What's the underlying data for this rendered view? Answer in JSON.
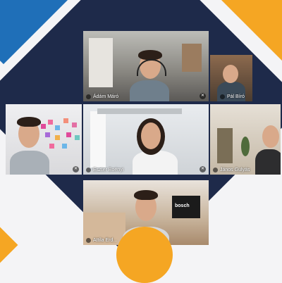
{
  "participants": [
    {
      "name": "Ádám Máró"
    },
    {
      "name": "Pál Bíró"
    },
    {
      "name": ""
    },
    {
      "name": "Eszter Boényi"
    },
    {
      "name": "János Gulyás"
    },
    {
      "name": "Attila Erd..."
    }
  ],
  "screen_label": "bosch",
  "colors": {
    "navy": "#1e2a4a",
    "orange": "#f5a623",
    "blue": "#1f6fb8"
  }
}
